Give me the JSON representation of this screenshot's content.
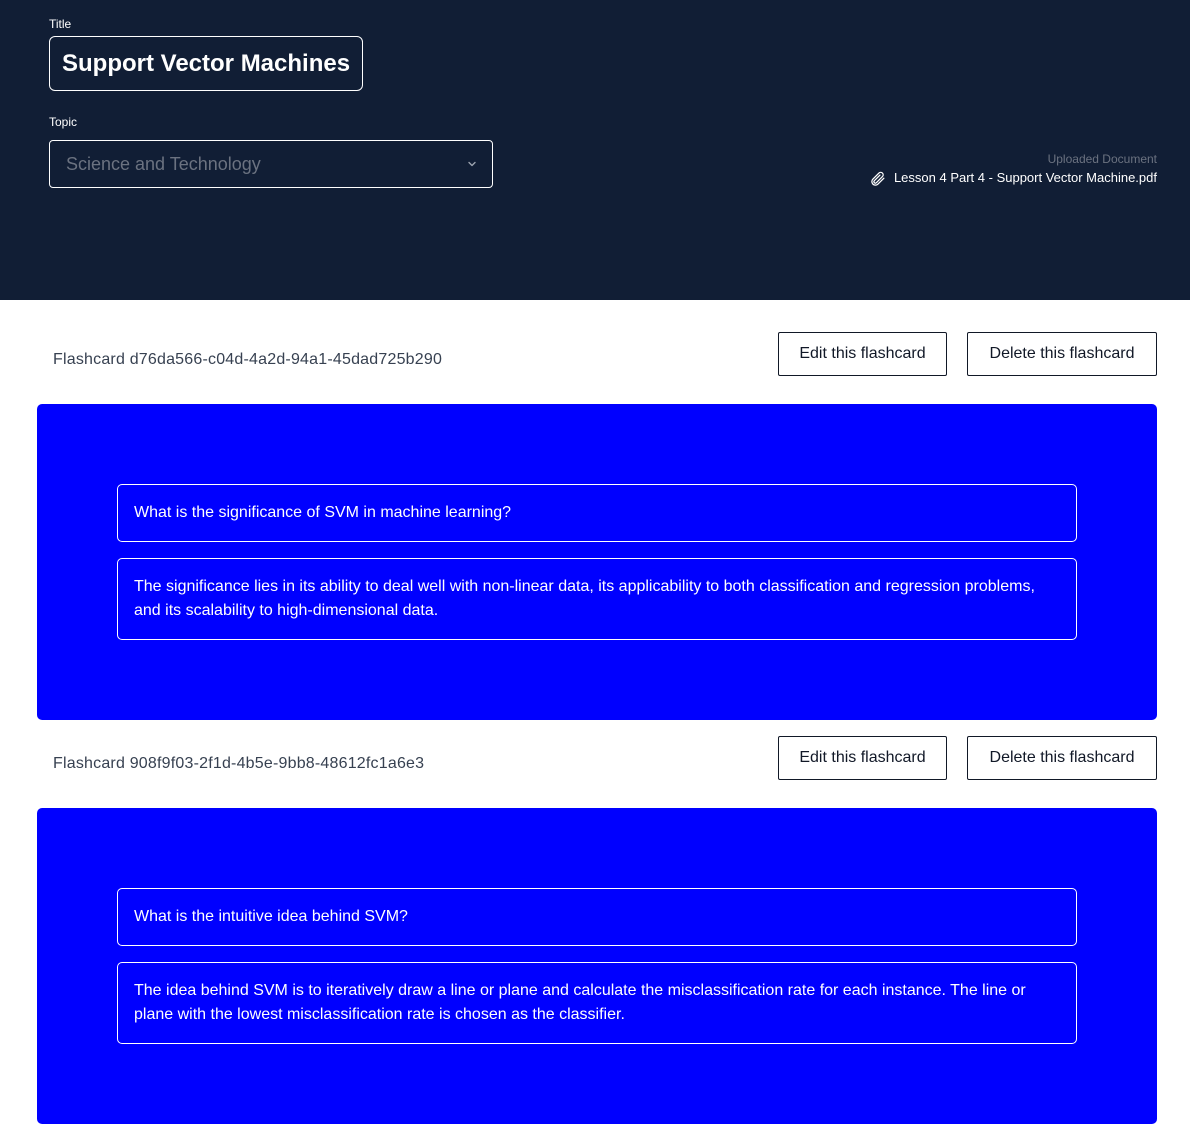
{
  "header": {
    "title_label": "Title",
    "title_value": "Support Vector Machines",
    "topic_label": "Topic",
    "topic_value": "Science and Technology",
    "uploaded_label": "Uploaded Document",
    "uploaded_file": "Lesson 4 Part 4 - Support Vector Machine.pdf",
    "icons": {
      "attachment": "paperclip-icon",
      "dropdown": "chevron-down-icon"
    }
  },
  "flashcards": [
    {
      "label": "Flashcard d76da566-c04d-4a2d-94a1-45dad725b290",
      "edit_label": "Edit this flashcard",
      "delete_label": "Delete this flashcard",
      "question": "What is the significance of SVM in machine learning?",
      "answer": "The significance lies in its ability to deal well with non-linear data, its applicability to both classification and regression problems, and its scalability to high-dimensional data."
    },
    {
      "label": "Flashcard 908f9f03-2f1d-4b5e-9bb8-48612fc1a6e3",
      "edit_label": "Edit this flashcard",
      "delete_label": "Delete this flashcard",
      "question": "What is the intuitive idea behind SVM?",
      "answer": "The idea behind SVM is to iteratively draw a line or plane and calculate the misclassification rate for each instance. The line or plane with the lowest misclassification rate is chosen as the classifier."
    }
  ],
  "colors": {
    "header_bg": "#111e35",
    "card_bg": "#0000ff",
    "placeholder_text": "#6b7280"
  }
}
